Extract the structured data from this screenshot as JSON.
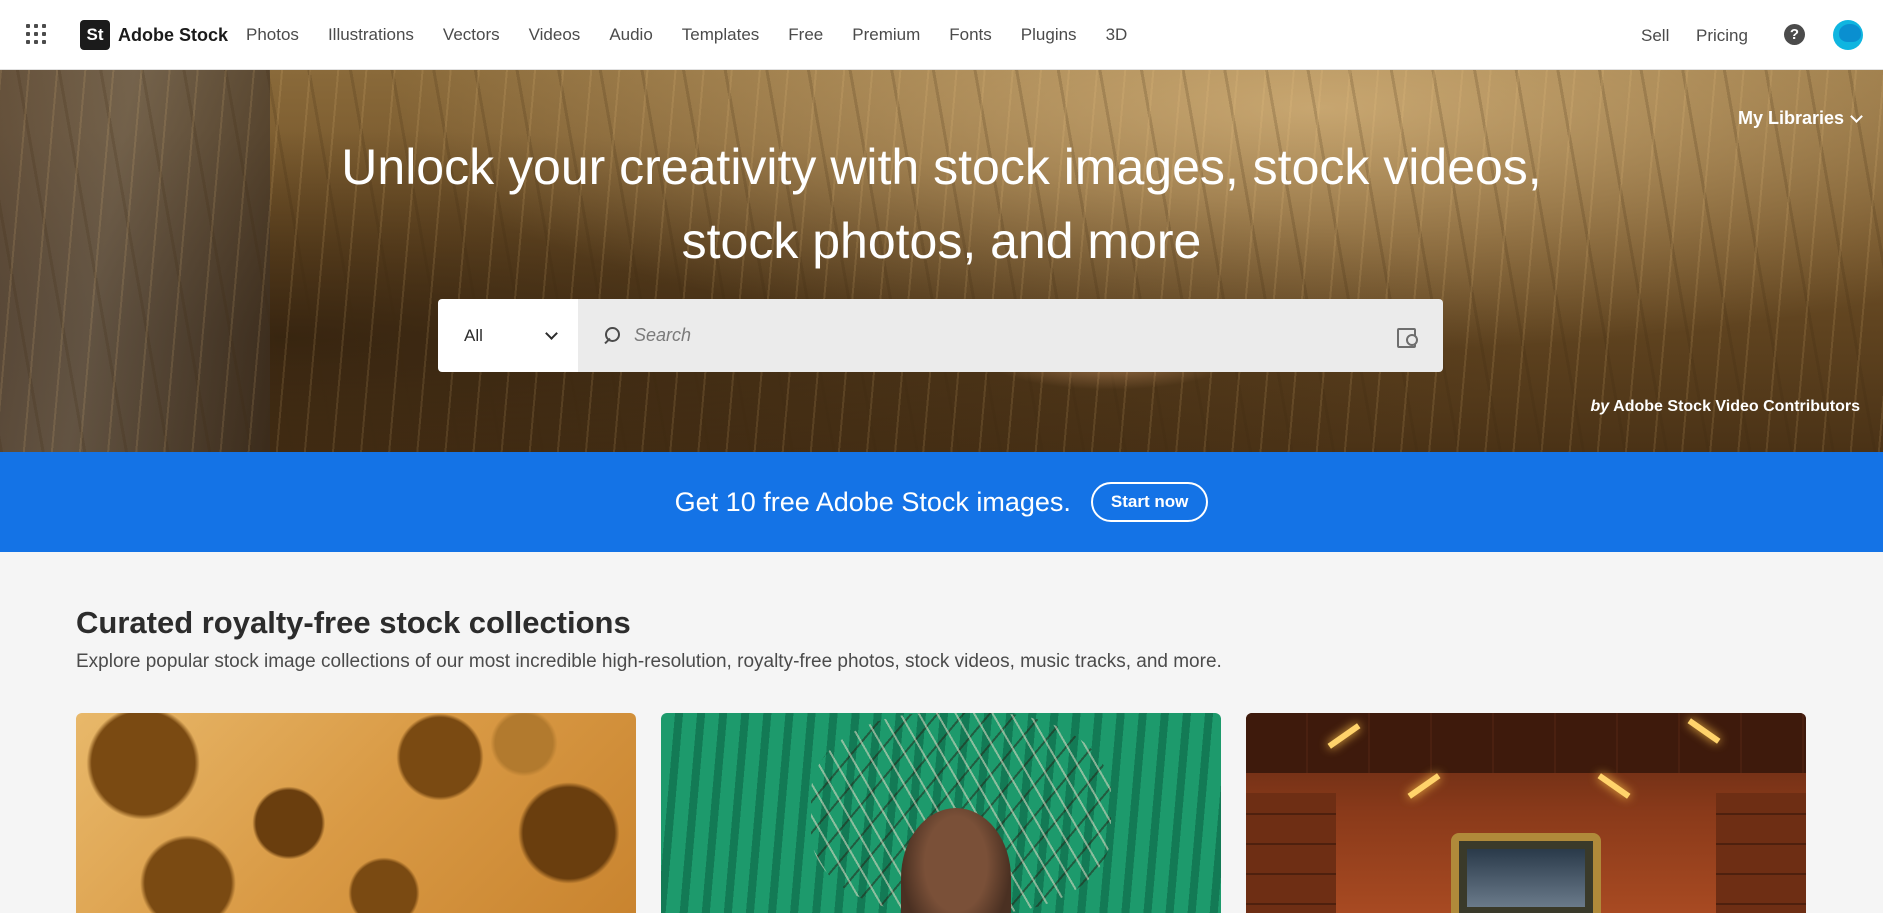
{
  "brand": {
    "badge": "St",
    "name": "Adobe Stock"
  },
  "nav": {
    "items": [
      {
        "label": "Photos"
      },
      {
        "label": "Illustrations"
      },
      {
        "label": "Vectors"
      },
      {
        "label": "Videos"
      },
      {
        "label": "Audio"
      },
      {
        "label": "Templates"
      },
      {
        "label": "Free"
      },
      {
        "label": "Premium"
      },
      {
        "label": "Fonts"
      },
      {
        "label": "Plugins"
      },
      {
        "label": "3D"
      }
    ],
    "sell": "Sell",
    "pricing": "Pricing",
    "help": "?"
  },
  "hero": {
    "my_libraries": "My Libraries",
    "title": "Unlock your creativity with stock images, stock videos, stock photos, and more",
    "search": {
      "category": "All",
      "placeholder": "Search"
    },
    "credit_by": "by",
    "credit_name": "Adobe Stock Video Contributors"
  },
  "promo": {
    "text": "Get 10 free Adobe Stock images.",
    "button": "Start now"
  },
  "collections": {
    "title": "Curated royalty-free stock collections",
    "description": "Explore popular stock image collections of our most incredible high-resolution, royalty-free photos, stock videos, music tracks, and more."
  },
  "colors": {
    "promo_blue": "#1473e6",
    "avatar": "#0fb5e0"
  }
}
